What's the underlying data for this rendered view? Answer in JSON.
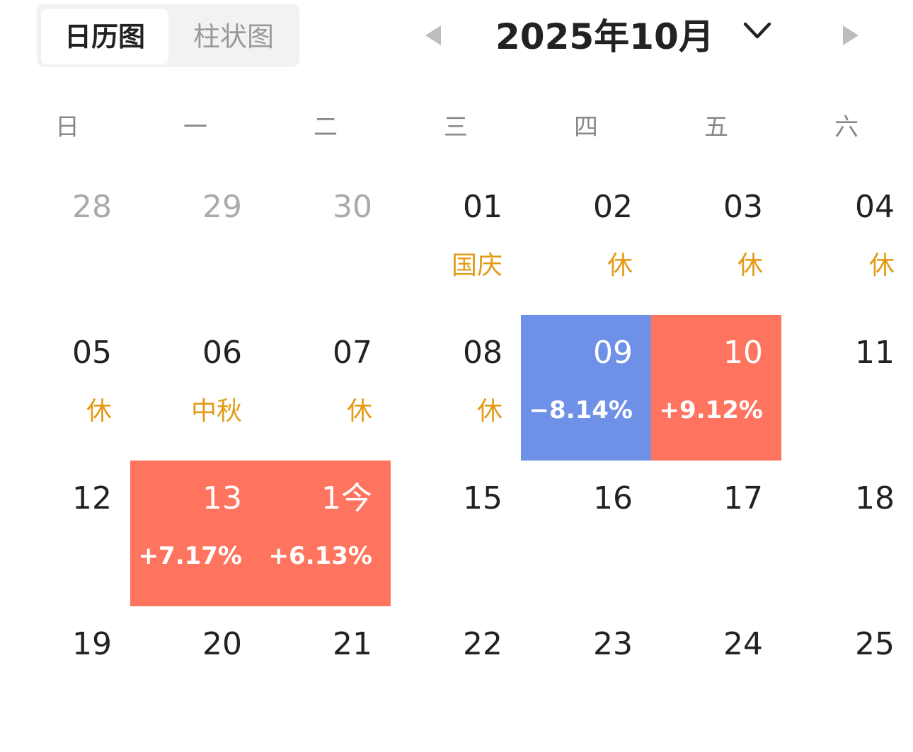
{
  "tabs": {
    "calendar_label": "日历图",
    "bar_label": "柱状图"
  },
  "header": {
    "title": "2025年10月"
  },
  "weekdays": [
    "日",
    "一",
    "二",
    "三",
    "四",
    "五",
    "六"
  ],
  "colors": {
    "up": "#fe745f",
    "down": "#6e90e6",
    "holiday": "#e39b16"
  },
  "weeks": [
    [
      {
        "day": "28",
        "other_month": true
      },
      {
        "day": "29",
        "other_month": true
      },
      {
        "day": "30",
        "other_month": true
      },
      {
        "day": "01",
        "tag": "国庆"
      },
      {
        "day": "02",
        "tag": "休"
      },
      {
        "day": "03",
        "tag": "休"
      },
      {
        "day": "04",
        "tag": "休"
      }
    ],
    [
      {
        "day": "05",
        "tag": "休"
      },
      {
        "day": "06",
        "tag": "中秋"
      },
      {
        "day": "07",
        "tag": "休"
      },
      {
        "day": "08",
        "tag": "休"
      },
      {
        "day": "09",
        "change": "−8.14%",
        "trend": "down"
      },
      {
        "day": "10",
        "change": "+9.12%",
        "trend": "up"
      },
      {
        "day": "11"
      }
    ],
    [
      {
        "day": "12"
      },
      {
        "day": "13",
        "change": "+7.17%",
        "trend": "up"
      },
      {
        "day": "1今",
        "change": "+6.13%",
        "trend": "up"
      },
      {
        "day": "15"
      },
      {
        "day": "16"
      },
      {
        "day": "17"
      },
      {
        "day": "18"
      }
    ],
    [
      {
        "day": "19"
      },
      {
        "day": "20"
      },
      {
        "day": "21"
      },
      {
        "day": "22"
      },
      {
        "day": "23"
      },
      {
        "day": "24"
      },
      {
        "day": "25"
      }
    ]
  ]
}
